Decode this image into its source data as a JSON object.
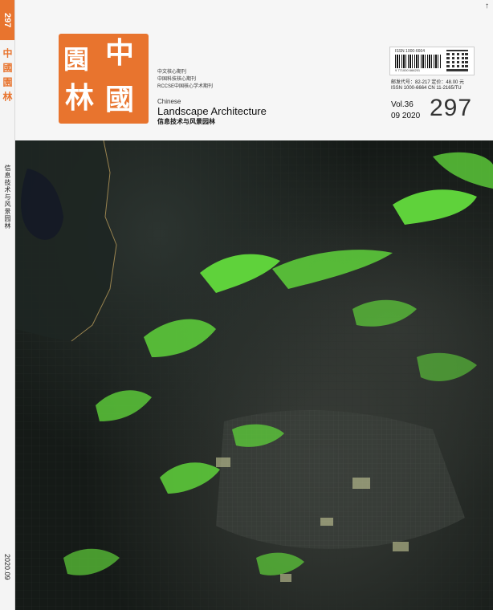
{
  "spine": {
    "issue": "297",
    "title_cn": "中國園林",
    "subtitle_cn": "信息技术与风景园林",
    "date": "2020.09"
  },
  "header": {
    "logo_chars": [
      "中",
      "國",
      "園",
      "林"
    ],
    "core_lines": [
      "中文核心期刊",
      "中国科技核心期刊",
      "RCCSE中国核心学术期刊"
    ],
    "chinese_label": "Chinese",
    "english_title": "Landscape Architecture",
    "subtitle_cn": "信息技术与风景园林",
    "barcode_issn": "ISSN 1000-6664",
    "barcode_number": "9 771000 666201",
    "price_line1": "邮发代号：82-217   定价：48.00 元",
    "price_line2": "ISSN 1000-6664   CN 11-2165/TU",
    "volume": "Vol.36",
    "issue_date": "09 2020",
    "issue_number": "297",
    "top_right_mark": "↑"
  },
  "colors": {
    "accent": "#e8742e",
    "map_background": "#151a17",
    "vegetation": "#5fd23b",
    "urban": "#3d433e"
  },
  "icons": {
    "logo": "orange-square-seal",
    "barcode": "barcode",
    "qr": "qr-code"
  }
}
